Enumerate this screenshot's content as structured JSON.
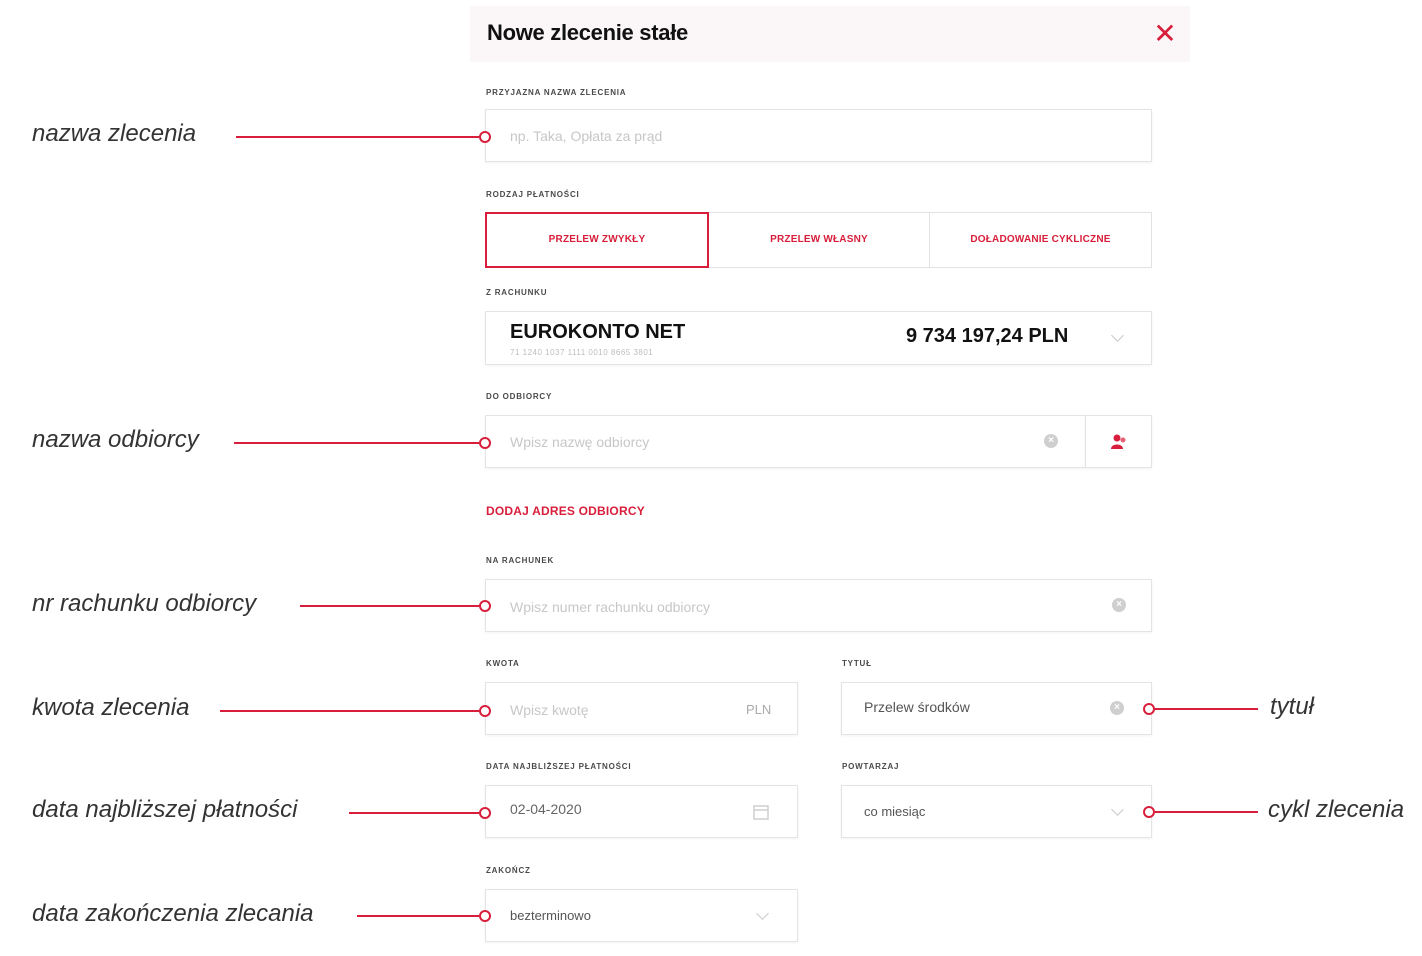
{
  "header": {
    "title": "Nowe zlecenie stałe",
    "close_icon": "close-icon"
  },
  "fields": {
    "order_name": {
      "label": "PRZYJAZNA NAZWA ZLECENIA",
      "placeholder": "np. Taka, Opłata za prąd"
    },
    "payment_type": {
      "label": "RODZAJ PŁATNOŚCI",
      "options": [
        "PRZELEW ZWYKŁY",
        "PRZELEW WŁASNY",
        "DOŁADOWANIE CYKLICZNE"
      ],
      "selected": "PRZELEW ZWYKŁY"
    },
    "from_account": {
      "label": "Z RACHUNKU",
      "account_name": "EUROKONTO NET",
      "account_number": "71 1240 1037 1111 0010 8665 3801",
      "balance": "9 734 197,24 PLN"
    },
    "recipient": {
      "label": "DO ODBIORCY",
      "placeholder": "Wpisz nazwę odbiorcy"
    },
    "add_address": "DODAJ ADRES ODBIORCY",
    "account_number": {
      "label": "NA RACHUNEK",
      "placeholder": "Wpisz numer rachunku odbiorcy"
    },
    "amount": {
      "label": "KWOTA",
      "placeholder": "Wpisz kwotę",
      "currency": "PLN"
    },
    "title": {
      "label": "TYTUŁ",
      "value": "Przelew środków"
    },
    "next_payment_date": {
      "label": "DATA NAJBLIŻSZEJ PŁATNOŚCI",
      "value": "02-04-2020"
    },
    "repeat": {
      "label": "POWTARZAJ",
      "value": "co miesiąc"
    },
    "end": {
      "label": "ZAKOŃCZ",
      "value": "bezterminowo"
    }
  },
  "annotations": {
    "order_name": "nazwa zlecenia",
    "recipient_name": "nazwa odbiorcy",
    "recipient_account": "nr rachunku odbiorcy",
    "amount": "kwota zlecenia",
    "next_date": "data najbliższej płatności",
    "end_date": "data zakończenia zlecania",
    "title": "tytuł",
    "cycle": "cykl zlecenia"
  },
  "colors": {
    "accent": "#d81e3a"
  }
}
